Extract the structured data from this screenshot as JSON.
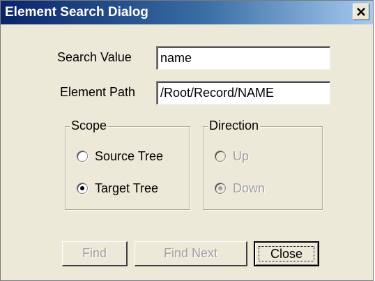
{
  "window": {
    "title": "Element Search Dialog",
    "close_icon": "close-x-icon"
  },
  "form": {
    "search_value": {
      "label": "Search Value",
      "value": "name"
    },
    "element_path": {
      "label": "Element Path",
      "value": "/Root/Record/NAME"
    }
  },
  "scope": {
    "legend": "Scope",
    "options": [
      {
        "label": "Source Tree",
        "checked": false,
        "enabled": true
      },
      {
        "label": "Target Tree",
        "checked": true,
        "enabled": true
      }
    ]
  },
  "direction": {
    "legend": "Direction",
    "options": [
      {
        "label": "Up",
        "checked": false,
        "enabled": false
      },
      {
        "label": "Down",
        "checked": true,
        "enabled": false
      }
    ]
  },
  "buttons": {
    "find": {
      "label": "Find",
      "enabled": false
    },
    "find_next": {
      "label": "Find Next",
      "enabled": false
    },
    "close": {
      "label": "Close",
      "enabled": true,
      "default": true
    }
  },
  "colors": {
    "title_start": "#0a246a",
    "title_end": "#a6caf0",
    "face": "#ece9d8",
    "disabled_text": "#a0a0a0"
  }
}
